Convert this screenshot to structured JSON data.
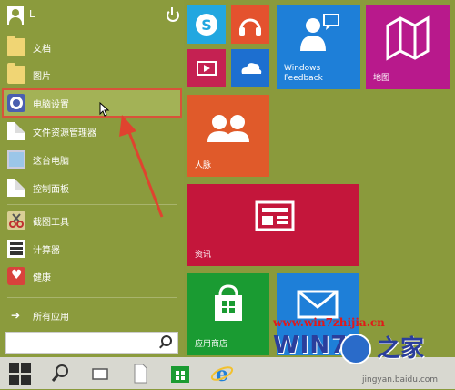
{
  "user": {
    "name": "L"
  },
  "menu_items": [
    {
      "label": "文档",
      "icon": "folder-icon"
    },
    {
      "label": "图片",
      "icon": "folder-icon"
    },
    {
      "label": "电脑设置",
      "icon": "gear-icon"
    },
    {
      "label": "文件资源管理器",
      "icon": "document-icon"
    },
    {
      "label": "这台电脑",
      "icon": "computer-icon"
    },
    {
      "label": "控制面板",
      "icon": "document-icon"
    },
    {
      "label": "截图工具",
      "icon": "scissors-icon"
    },
    {
      "label": "计算器",
      "icon": "calculator-icon"
    },
    {
      "label": "健康",
      "icon": "heart-icon"
    }
  ],
  "all_apps": {
    "label": "所有应用"
  },
  "search": {
    "value": "",
    "placeholder": ""
  },
  "tiles": {
    "feedback": "Windows Feedback",
    "maps": "地图",
    "people": "人脉",
    "news": "资讯",
    "store": "应用商店",
    "mail": ""
  },
  "watermark": {
    "url": "www.win7zhijia.cn",
    "brand": "WIN7",
    "brand_suffix": "之家",
    "source": "jingyan.baidu.com"
  },
  "colors": {
    "background": "#8a9a3c",
    "selection_outline": "#d8533a",
    "annotation_arrow": "#e0432f"
  }
}
